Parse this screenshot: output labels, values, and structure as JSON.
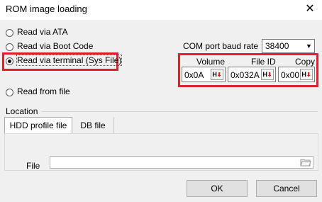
{
  "window": {
    "title": "ROM image loading",
    "close_glyph": "✕"
  },
  "read_options": [
    {
      "label": "Read via ATA",
      "checked": false
    },
    {
      "label": "Read via Boot Code",
      "checked": false
    },
    {
      "label": "Read via terminal (Sys File)",
      "checked": true
    },
    {
      "label": "Read from file",
      "checked": false
    }
  ],
  "com_port": {
    "label": "COM port baud rate",
    "value": "38400"
  },
  "fields": {
    "volume": {
      "label": "Volume",
      "value": "0x0A"
    },
    "file_id": {
      "label": "File ID",
      "value": "0x032A"
    },
    "copy": {
      "label": "Copy",
      "value": "0x00"
    },
    "hex_button": "H"
  },
  "location": {
    "label": "Location",
    "tabs": [
      {
        "label": "HDD profile file",
        "active": true
      },
      {
        "label": "DB file",
        "active": false
      }
    ],
    "file_label": "File",
    "file_value": ""
  },
  "buttons": {
    "ok": "OK",
    "cancel": "Cancel"
  },
  "colors": {
    "highlight": "#e0202a",
    "hex_arrow": "#d21b1b"
  }
}
